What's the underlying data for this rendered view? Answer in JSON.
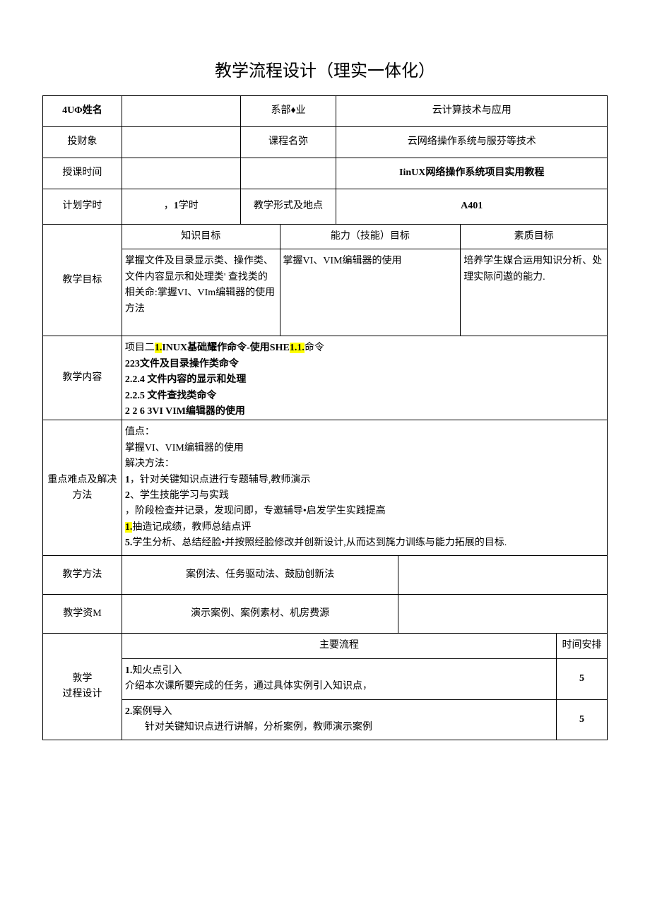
{
  "title": "教学流程设计（理实一体化）",
  "rows": {
    "r1": {
      "label": "4UΦ姓名",
      "c2": "",
      "c3": "系部♦业",
      "c4": "云计算技术与应用"
    },
    "r2": {
      "label": "投财象",
      "c2": "",
      "c3": "课程名弥",
      "c4": "云网络操作系统与服芬等技术"
    },
    "r3": {
      "label": "授课时间",
      "c2": "",
      "c3": "",
      "c4": "IinUX网络操作系统项目实用教程"
    },
    "r4": {
      "label": "计划学时",
      "c2": "，1学时",
      "c3": "教学形式及地点",
      "c4": "A401"
    }
  },
  "goals": {
    "label": "教学目标",
    "h1": "知识目标",
    "h2": "能力（技能）目标",
    "h3": "素质目标",
    "c1": "掌握文件及目录显示类、操作类、文件内容显示和处理类' 查找类的相关命:掌握VI、VIm编辑器的使用方法",
    "c2": "掌握VI、VIM编辑器的使用",
    "c3": "培养学生媒合运用知识分析、处理实际问遨的能力."
  },
  "content": {
    "label": "教学内容",
    "line1a": "项目二",
    "line1b": "1.",
    "line1c": "INUX基础耀作命令-使用SHE",
    "line1d": "1.1.",
    "line1e": "命令",
    "line2": "223文件及目录操作类命令",
    "line3": "2.2.4 文件内容的显示和处理",
    "line4": "2.2.5 文件查找类命令",
    "line5": "2 2 6 3VI   VIM编辑器的使用"
  },
  "difficulty": {
    "label": "重点难点及解决方法",
    "line1": "值点：",
    "line2": "掌握VI、VIM编辑器的使用",
    "line3": "解决方法：",
    "line4": "1，针对关键知识点进行专题辅导,教师演示",
    "line5": "2、学生技能学习与实践",
    "line6": "，阶段检查并记录，发现问即，专邀辅导•启发学生实践提高",
    "line7a": "1.",
    "line7b": "抽造记成绩，教师总结点评",
    "line8": "5.学生分析、总结经脸•并按照经脸修改并创新设计,从而达到旄力训练与能力拓展的目标."
  },
  "method": {
    "label": "教学方法",
    "value": "案例法、任务驱动法、鼓励创新法"
  },
  "resource": {
    "label": "教学资M",
    "value": "演示案例、案例素材、机房费源"
  },
  "process": {
    "label": "敦学\n过程设计",
    "h1": "主要流程",
    "h2": "时间安排",
    "r1": {
      "text": "1.知火点引入\n介绍本次课所要完成的任务，通过具体实例引入知识点，",
      "time": "5"
    },
    "r2": {
      "text": "2.案例导入\n　　针对关键知识点进行讲解，分析案例，教师演示案例",
      "time": "5"
    }
  }
}
